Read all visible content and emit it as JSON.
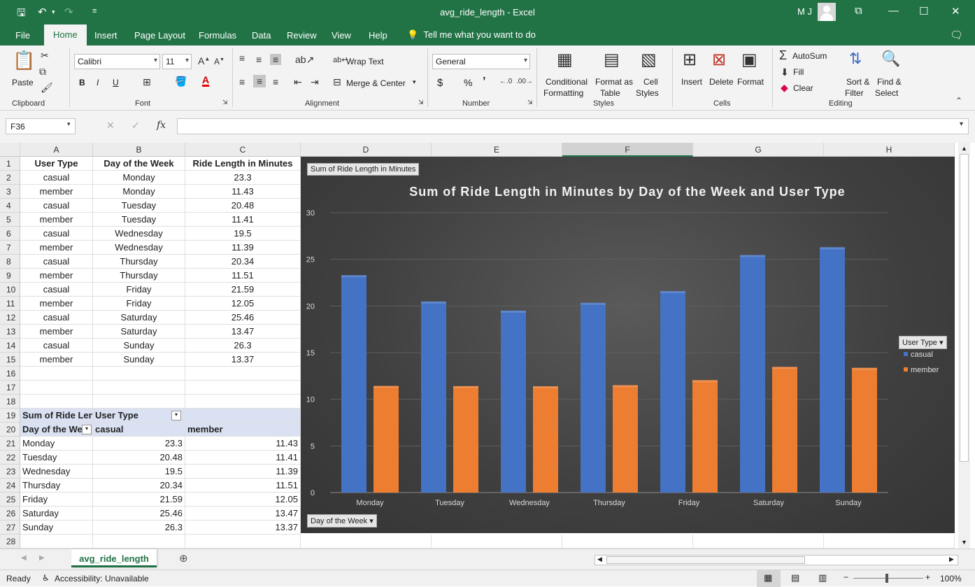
{
  "titlebar": {
    "doc_title": "avg_ride_length  -  Excel",
    "user_initials": "M J"
  },
  "menu": {
    "tabs": [
      "File",
      "Home",
      "Insert",
      "Page Layout",
      "Formulas",
      "Data",
      "Review",
      "View",
      "Help"
    ],
    "active": "Home",
    "tell_me": "Tell me what you want to do"
  },
  "ribbon": {
    "clipboard": {
      "paste": "Paste",
      "label": "Clipboard"
    },
    "font": {
      "name": "Calibri",
      "size": "11",
      "label": "Font",
      "bold": "B",
      "italic": "I",
      "underline": "U"
    },
    "alignment": {
      "wrap": "Wrap Text",
      "merge": "Merge & Center",
      "label": "Alignment"
    },
    "number": {
      "format": "General",
      "label": "Number",
      "currency": "$",
      "percent": "%",
      "comma": "’"
    },
    "styles": {
      "conditional_1": "Conditional",
      "conditional_2": "Formatting",
      "format_table_1": "Format as",
      "format_table_2": "Table",
      "cell_styles_1": "Cell",
      "cell_styles_2": "Styles",
      "label": "Styles"
    },
    "cells": {
      "insert": "Insert",
      "delete": "Delete",
      "format": "Format",
      "label": "Cells"
    },
    "editing": {
      "autosum": "AutoSum",
      "fill": "Fill",
      "clear": "Clear",
      "sort_1": "Sort &",
      "sort_2": "Filter",
      "find_1": "Find &",
      "find_2": "Select",
      "label": "Editing"
    }
  },
  "formula_bar": {
    "name_box": "F36",
    "formula": ""
  },
  "columns": [
    "A",
    "B",
    "C",
    "D",
    "E",
    "F",
    "G",
    "H"
  ],
  "rows": [
    "1",
    "2",
    "3",
    "4",
    "5",
    "6",
    "7",
    "8",
    "9",
    "10",
    "11",
    "12",
    "13",
    "14",
    "15",
    "16",
    "17",
    "18",
    "19",
    "20",
    "21",
    "22",
    "23",
    "24",
    "25",
    "26",
    "27",
    "28"
  ],
  "table": {
    "headers": [
      "User Type",
      "Day of the Week",
      "Ride Length in Minutes"
    ],
    "rows": [
      [
        "casual",
        "Monday",
        "23.3"
      ],
      [
        "member",
        "Monday",
        "11.43"
      ],
      [
        "casual",
        "Tuesday",
        "20.48"
      ],
      [
        "member",
        "Tuesday",
        "11.41"
      ],
      [
        "casual",
        "Wednesday",
        "19.5"
      ],
      [
        "member",
        "Wednesday",
        "11.39"
      ],
      [
        "casual",
        "Thursday",
        "20.34"
      ],
      [
        "member",
        "Thursday",
        "11.51"
      ],
      [
        "casual",
        "Friday",
        "21.59"
      ],
      [
        "member",
        "Friday",
        "12.05"
      ],
      [
        "casual",
        "Saturday",
        "25.46"
      ],
      [
        "member",
        "Saturday",
        "13.47"
      ],
      [
        "casual",
        "Sunday",
        "26.3"
      ],
      [
        "member",
        "Sunday",
        "13.37"
      ]
    ]
  },
  "pivot": {
    "value_field": "Sum of Ride Leng",
    "column_field": "User Type",
    "row_field": "Day of the We",
    "col_headers": [
      "casual",
      "member"
    ],
    "rows": [
      [
        "Monday",
        "23.3",
        "11.43"
      ],
      [
        "Tuesday",
        "20.48",
        "11.41"
      ],
      [
        "Wednesday",
        "19.5",
        "11.39"
      ],
      [
        "Thursday",
        "20.34",
        "11.51"
      ],
      [
        "Friday",
        "21.59",
        "12.05"
      ],
      [
        "Saturday",
        "25.46",
        "13.47"
      ],
      [
        "Sunday",
        "26.3",
        "13.37"
      ]
    ]
  },
  "chart_field_buttons": {
    "values": "Sum of Ride Length in Minutes",
    "legend": "User Type",
    "axis": "Day of the Week"
  },
  "chart_data": {
    "type": "bar",
    "title": "Sum of Ride Length in Minutes by Day of the Week and User Type",
    "categories": [
      "Monday",
      "Tuesday",
      "Wednesday",
      "Thursday",
      "Friday",
      "Saturday",
      "Sunday"
    ],
    "series": [
      {
        "name": "casual",
        "values": [
          23.3,
          20.48,
          19.5,
          20.34,
          21.59,
          25.46,
          26.3
        ],
        "color": "#4472c4"
      },
      {
        "name": "member",
        "values": [
          11.43,
          11.41,
          11.39,
          11.51,
          12.05,
          13.47,
          13.37
        ],
        "color": "#ed7d31"
      }
    ],
    "ylim": [
      0,
      30
    ],
    "yticks": [
      "0",
      "5",
      "10",
      "15",
      "20",
      "25",
      "30"
    ],
    "grid": true,
    "legend_position": "right",
    "background": "#404040"
  },
  "sheets": {
    "active": "avg_ride_length"
  },
  "status": {
    "ready": "Ready",
    "accessibility": "Accessibility: Unavailable",
    "zoom": "100%"
  }
}
